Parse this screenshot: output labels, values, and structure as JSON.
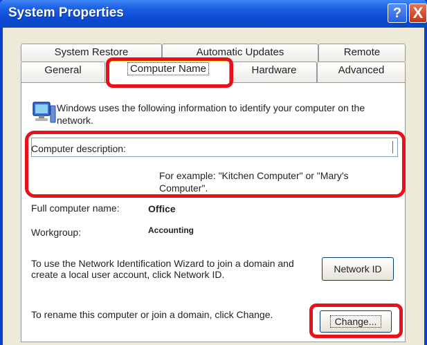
{
  "window": {
    "title": "System Properties"
  },
  "titlebar": {
    "help_glyph": "?",
    "close_glyph": "X"
  },
  "tabs": {
    "row_top": [
      {
        "label": "System Restore"
      },
      {
        "label": "Automatic Updates"
      },
      {
        "label": "Remote"
      }
    ],
    "row_bottom": [
      {
        "label": "General"
      },
      {
        "label": "Computer Name",
        "active": true
      },
      {
        "label": "Hardware"
      },
      {
        "label": "Advanced"
      }
    ]
  },
  "computer_name_tab": {
    "intro_text": "Windows uses the following information to identify your computer on the network.",
    "description_label": "Computer description:",
    "description_value": "",
    "description_example": "For example: \"Kitchen Computer\" or \"Mary's Computer\".",
    "full_name_label": "Full computer name:",
    "full_name_value": "Office",
    "workgroup_label": "Workgroup:",
    "workgroup_value": "Accounting",
    "network_id_text": "To use the Network Identification Wizard to join a domain and create a local user account, click Network ID.",
    "network_id_button": "Network ID",
    "change_text": "To rename this computer or join a domain, click Change.",
    "change_button": "Change..."
  },
  "annotations": {
    "highlight_color": "#e8101a"
  }
}
